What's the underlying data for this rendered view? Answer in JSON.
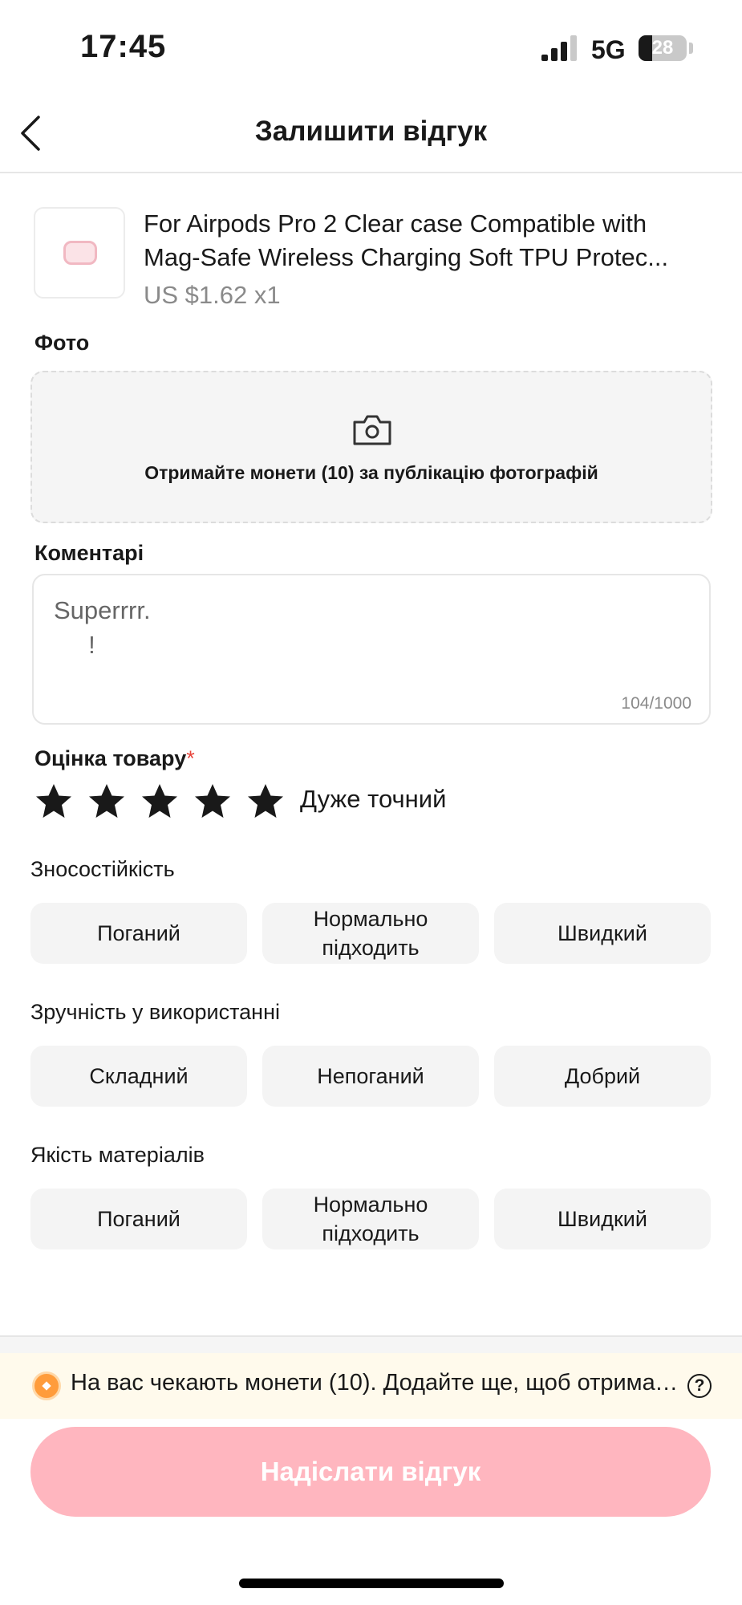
{
  "status_bar": {
    "time": "17:45",
    "network": "5G",
    "battery": "28",
    "battery_percent": 28
  },
  "header": {
    "title": "Залишити відгук",
    "back_icon": "chevron-left-icon"
  },
  "product": {
    "name_line1": "For  Airpods Pro 2 Clear case Compatible with",
    "name_line2": "Mag-Safe Wireless Charging Soft TPU Protec...",
    "price": "US $1.62 x1"
  },
  "photo": {
    "label": "Фото",
    "hint": "Отримайте монети (10) за публікацію фотографій",
    "icon": "camera-icon"
  },
  "comments": {
    "label": "Коментарі",
    "text": "Superrrr.\n     !",
    "counter": "104/1000"
  },
  "rating": {
    "label": "Оцінка товару",
    "required_mark": "*",
    "stars": 5,
    "max_stars": 5,
    "word": "Дуже точний"
  },
  "attributes": [
    {
      "label": "Зносостійкість",
      "options": [
        "Поганий",
        "Нормально\nпідходить",
        "Швидкий"
      ]
    },
    {
      "label": "Зручність у використанні",
      "options": [
        "Складний",
        "Непоганий",
        "Добрий"
      ]
    },
    {
      "label": "Якість матеріалів",
      "options": [
        "Поганий",
        "Нормально\nпідходить",
        "Швидкий"
      ]
    }
  ],
  "footer": {
    "coin_text": "На вас чекають монети (10). Додайте ще, щоб отримати...",
    "help_glyph": "?",
    "submit_label": "Надіслати відгук",
    "colors": {
      "submit_bg": "#ffb6bf",
      "coin_bar_bg": "#fffaec",
      "coin": "#ff9c3b"
    }
  }
}
